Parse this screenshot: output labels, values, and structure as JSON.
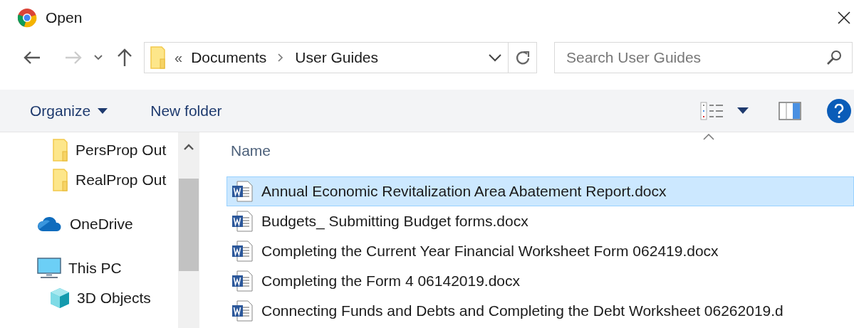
{
  "window": {
    "title": "Open"
  },
  "address_bar": {
    "overflow": "«",
    "path": [
      "Documents",
      "User Guides"
    ]
  },
  "search": {
    "placeholder": "Search User Guides"
  },
  "toolbar": {
    "organize": "Organize",
    "new_folder": "New folder"
  },
  "nav_pane": {
    "items": [
      {
        "label": "PersProp Out",
        "kind": "folder"
      },
      {
        "label": "RealProp Out",
        "kind": "folder"
      },
      {
        "label": "OneDrive",
        "kind": "cloud"
      },
      {
        "label": "This PC",
        "kind": "pc",
        "children": [
          {
            "label": "3D Objects",
            "kind": "cube"
          }
        ]
      }
    ]
  },
  "file_list": {
    "column_header": "Name",
    "rows": [
      {
        "name": "Annual Economic Revitalization Area Abatement Report.docx",
        "selected": true
      },
      {
        "name": "Budgets_ Submitting Budget forms.docx",
        "selected": false
      },
      {
        "name": "Completing the Current Year Financial Worksheet Form 062419.docx",
        "selected": false
      },
      {
        "name": "Completing the Form 4 06142019.docx",
        "selected": false
      },
      {
        "name": "Connecting Funds and Debts and Completing the Debt Worksheet 06262019.d",
        "selected": false
      }
    ]
  }
}
